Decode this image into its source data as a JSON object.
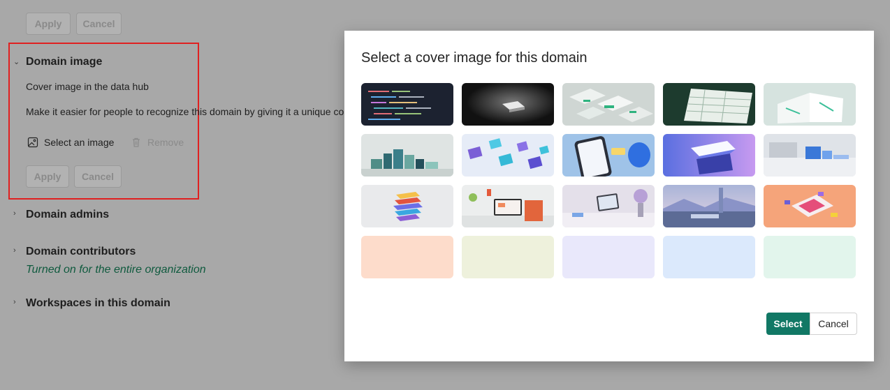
{
  "background": {
    "top_apply_label": "Apply",
    "top_cancel_label": "Cancel",
    "domain_image": {
      "title": "Domain image",
      "subtitle": "Cover image in the data hub",
      "description": "Make it easier for people to recognize this domain by giving it a unique co",
      "select_label": "Select an image",
      "remove_label": "Remove",
      "apply_label": "Apply",
      "cancel_label": "Cancel"
    },
    "sections": {
      "admins": "Domain admins",
      "contributors": "Domain contributors",
      "contributors_status": "Turned on for the entire organization",
      "workspaces": "Workspaces in this domain"
    }
  },
  "dialog": {
    "title": "Select a cover image for this domain",
    "select_label": "Select",
    "cancel_label": "Cancel",
    "solid_colors": [
      "#fddccb",
      "#eef1dc",
      "#e9e8fb",
      "#dbe9fc",
      "#e2f5ec"
    ]
  }
}
